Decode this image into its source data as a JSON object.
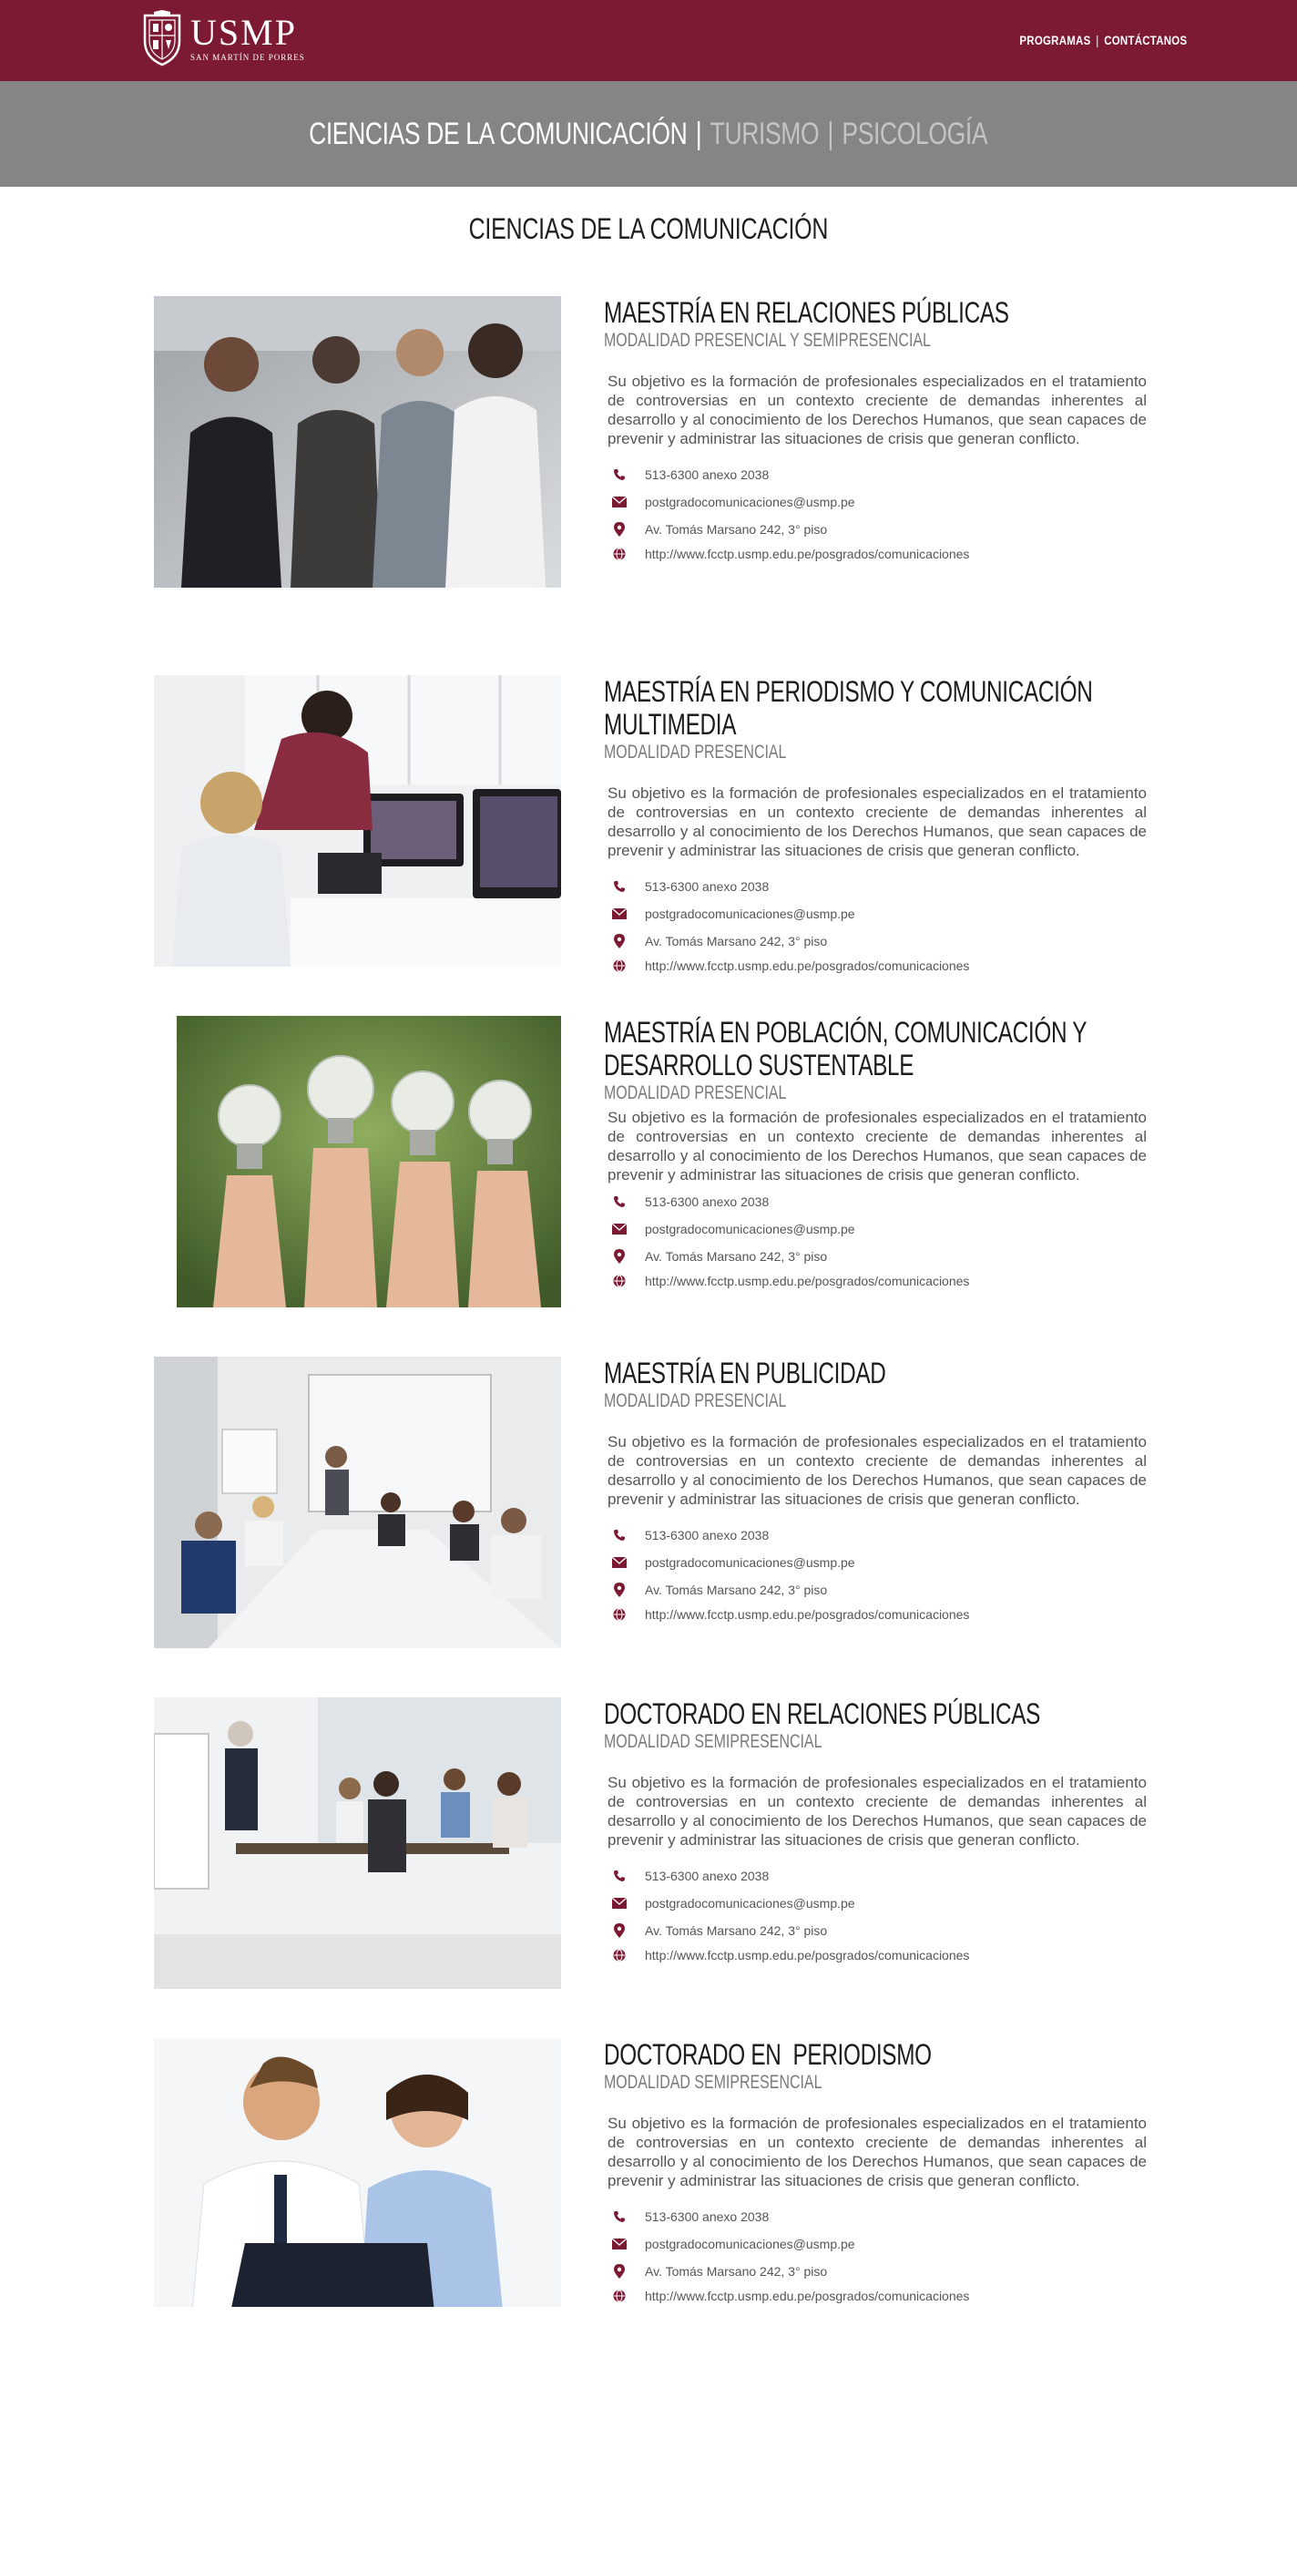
{
  "header": {
    "logo_name": "USMP",
    "logo_sub": "SAN MARTÍN DE PORRES",
    "nav": [
      "PROGRAMAS",
      "CONTÁCTANOS"
    ],
    "nav_separator": "|",
    "brand_color": "#7d1a33"
  },
  "tabs": {
    "items": [
      "CIENCIAS DE LA COMUNICACIÓN",
      "TURISMO",
      "PSICOLOGÍA"
    ],
    "active_index": 0,
    "separator": "|"
  },
  "section_title": "CIENCIAS DE LA COMUNICACIÓN",
  "programs": [
    {
      "title": "MAESTRÍA EN RELACIONES PÚBLICAS",
      "modality": "MODALIDAD PRESENCIAL Y SEMIPRESENCIAL",
      "description": "Su objetivo es la formación de profesionales especializados en el trata­miento de controversias en un contexto creciente de demandas inherentes al desarrollo y al conocimiento de los Derechos Humanos, que sean capa­ces de prevenir y administrar las situaciones de crisis que generan conflic­to.",
      "phone": "513-6300 anexo 2038",
      "email": "postgradocomunicaciones@usmp.pe",
      "address": "Av. Tomás Marsano 242, 3° piso",
      "web": "http://www.fcctp.usmp.edu.pe/posgrados/comunicaciones",
      "photo_icon": "team-photo"
    },
    {
      "title": "MAESTRÍA EN PERIODISMO Y COMUNICACIÓN MULTIMEDIA",
      "modality": "MODALIDAD PRESENCIAL",
      "description": "Su objetivo es la formación de profesionales especializados en el trata­miento de controversias en un contexto creciente de demandas inherentes al desarrollo y al conocimiento de los Derechos Humanos, que sean capa­ces de prevenir y administrar las situaciones de crisis que generan conflic­to.",
      "phone": "513-6300 anexo 2038",
      "email": "postgradocomunicaciones@usmp.pe",
      "address": "Av. Tomás Marsano 242, 3° piso",
      "web": "http://www.fcctp.usmp.edu.pe/posgrados/comunicaciones",
      "photo_icon": "monitors-photo"
    },
    {
      "title": "MAESTRÍA EN POBLACIÓN, COMUNICACIÓN Y DESARROLLO SUSTENTABLE",
      "modality": "MODALIDAD PRESENCIAL",
      "description": "Su objetivo es la formación de profesionales especializados en el trata­miento de controversias en un contexto creciente de demandas inherentes al desarrollo y al conocimiento de los Derechos Humanos, que sean capa­ces de prevenir y administrar las situaciones de crisis que generan conflic­to.",
      "phone": "513-6300 anexo 2038",
      "email": "postgradocomunicaciones@usmp.pe",
      "address": "Av. Tomás Marsano 242, 3° piso",
      "web": "http://www.fcctp.usmp.edu.pe/posgrados/comunicaciones",
      "photo_icon": "lightbulbs-photo"
    },
    {
      "title": "MAESTRÍA EN PUBLICIDAD",
      "modality": "MODALIDAD PRESENCIAL",
      "description": "Su objetivo es la formación de profesionales especializados en el trata­miento de controversias en un contexto creciente de demandas inherentes al desarrollo y al conocimiento de los Derechos Humanos, que sean capa­ces de prevenir y administrar las situaciones de crisis que generan conflic­to.",
      "phone": "513-6300 anexo 2038",
      "email": "postgradocomunicaciones@usmp.pe",
      "address": "Av. Tomás Marsano 242, 3° piso",
      "web": "http://www.fcctp.usmp.edu.pe/posgrados/comunicaciones",
      "photo_icon": "meeting-room-photo"
    },
    {
      "title": "DOCTORADO EN RELACIONES PÚBLICAS",
      "modality": "MODALIDAD SEMIPRESENCIAL",
      "description": "Su objetivo es la formación de profesionales especializados en el trata­miento de controversias en un contexto creciente de demandas inherentes al desarrollo y al conocimiento de los Derechos Humanos, que sean capa­ces de prevenir y administrar las situaciones de crisis que generan conflic­to.",
      "phone": "513-6300 anexo 2038",
      "email": "postgradocomunicaciones@usmp.pe",
      "address": "Av. Tomás Marsano 242, 3° piso",
      "web": "http://www.fcctp.usmp.edu.pe/posgrados/comunicaciones",
      "photo_icon": "presentation-photo"
    },
    {
      "title": "DOCTORADO EN  PERIODISMO",
      "modality": "MODALIDAD SEMIPRESENCIAL",
      "description": "Su objetivo es la formación de profesionales especializados en el trata­miento de controversias en un contexto creciente de demandas inherentes al desarrollo y al conocimiento de los Derechos Humanos, que sean capa­ces de prevenir y administrar las situaciones de crisis que generan conflic­to.",
      "phone": "513-6300 anexo 2038",
      "email": "postgradocomunicaciones@usmp.pe",
      "address": "Av. Tomás Marsano 242, 3° piso",
      "web": "http://www.fcctp.usmp.edu.pe/posgrados/comunicaciones",
      "photo_icon": "laptop-duo-photo"
    }
  ]
}
